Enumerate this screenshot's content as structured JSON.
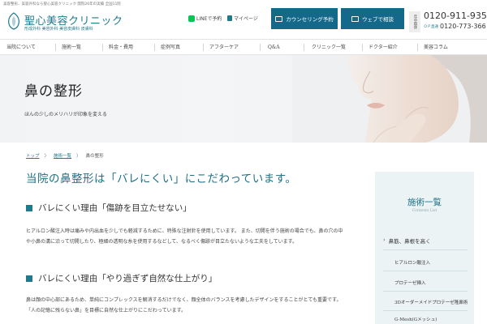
{
  "header": {
    "tagline": "美容整形、美容外科なら聖心美容クリニック 開院26年の実績 全国11院",
    "logo_title": "聖心美容クリニック",
    "logo_sub": "形成外科 美容外科 美容皮膚科 皮膚科",
    "line_label": "LINEで予約",
    "mypage_label": "マイページ",
    "counseling_btn": "カウンセリング予約",
    "web_btn": "ウェブで相談",
    "hours_label": "年中無休",
    "phone_main": "0120-911-935",
    "phone_sub": "0120-773-366",
    "phone_sub_tag": "ＯＰ直通"
  },
  "nav": {
    "items": [
      "当院について",
      "施術一覧",
      "料金・費用",
      "症例写真",
      "アフターケア",
      "Q&A",
      "クリニック一覧",
      "ドクター紹介",
      "美容コラム"
    ]
  },
  "hero": {
    "title": "鼻の整形",
    "subtitle": "ほんの少しのメリハリが印象を変える"
  },
  "breadcrumb": {
    "home": "トップ",
    "sep1": "〉",
    "list": "施術一覧",
    "sep2": "〉",
    "current": "鼻の整形"
  },
  "main": {
    "title": "当院の鼻整形は「バレにくい」にこだわっています。",
    "section1_title": "バレにくい理由「傷跡を目立たせない」",
    "section1_text": "ヒアルロン酸注入時は痛みや内出血を少しでも軽減するために、特殊な注射針を使用しています。 また、切開を伴う施術の場合でも、鼻の穴の中や小鼻の溝に沿って切開したり、極細の透明な糸を使用するなどして、なるべく傷跡が目立たないような工夫をしています。",
    "section2_title": "バレにくい理由「やり過ぎず自然な仕上がり」",
    "section2_text": "鼻は顔の中心部にあるため、単純にコンプレックスを解消するだけでなく、顔全体のバランスを考慮したデザインをすることがとても重要です。「人の記憶に残らない鼻」を目標に自然な仕上がりにこだわっています。"
  },
  "sidebar": {
    "title": "施術一覧",
    "subtitle": "Contents List",
    "category": "鼻筋、鼻根を高く",
    "category_arrow": "›",
    "items": [
      "ヒアルロン酸注入",
      "プロテーゼ挿入",
      "3Dオーダーメイドプロテーゼ隆鼻術",
      "G-Mesh(Gメッシュ)"
    ]
  },
  "colors": {
    "accent": "#1f7a8c",
    "button": "#14698a",
    "sidebar_bg": "#ecf3f5",
    "line_green": "#06c755"
  }
}
